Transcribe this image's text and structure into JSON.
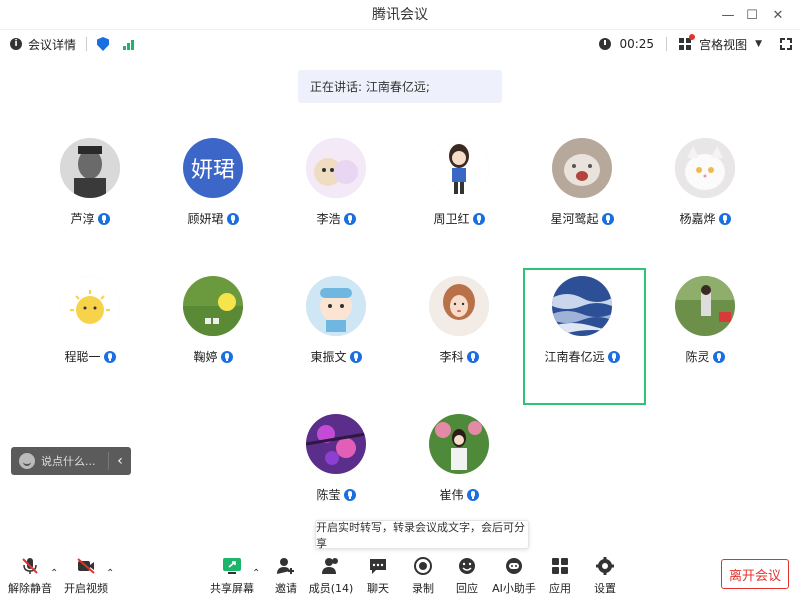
{
  "window": {
    "title": "腾讯会议"
  },
  "info_bar": {
    "details_label": "会议详情",
    "timer": "00:25",
    "view_label": "宫格视图"
  },
  "speaking_banner": "正在讲话: 江南春亿远;",
  "participants": [
    {
      "name": "芦淳"
    },
    {
      "name": "顾妍珺",
      "initials": "妍珺"
    },
    {
      "name": "李浩"
    },
    {
      "name": "周卫红"
    },
    {
      "name": "星河鹭起"
    },
    {
      "name": "杨嘉烨"
    },
    {
      "name": "程聪一"
    },
    {
      "name": "鞠婷"
    },
    {
      "name": "東振文"
    },
    {
      "name": "李科"
    },
    {
      "name": "江南春亿远"
    },
    {
      "name": "陈灵"
    },
    {
      "name": "陈莹"
    },
    {
      "name": "崔伟"
    }
  ],
  "chat_input": {
    "placeholder": "说点什么..."
  },
  "transcription_tip": "开启实时转写，转录会议成文字，会后可分享",
  "toolbar": {
    "unmute": "解除静音",
    "start_video": "开启视频",
    "share_screen": "共享屏幕",
    "invite": "邀请",
    "members": "成员(14)",
    "chat": "聊天",
    "record": "录制",
    "replay": "回应",
    "ai_assistant": "AI小助手",
    "apps": "应用",
    "settings": "设置",
    "leave": "离开会议"
  },
  "colors": {
    "accent": "#1a6fe0",
    "active_speaker": "#2fc27b",
    "leave": "#e5322d",
    "signal": "#1cb56a"
  }
}
